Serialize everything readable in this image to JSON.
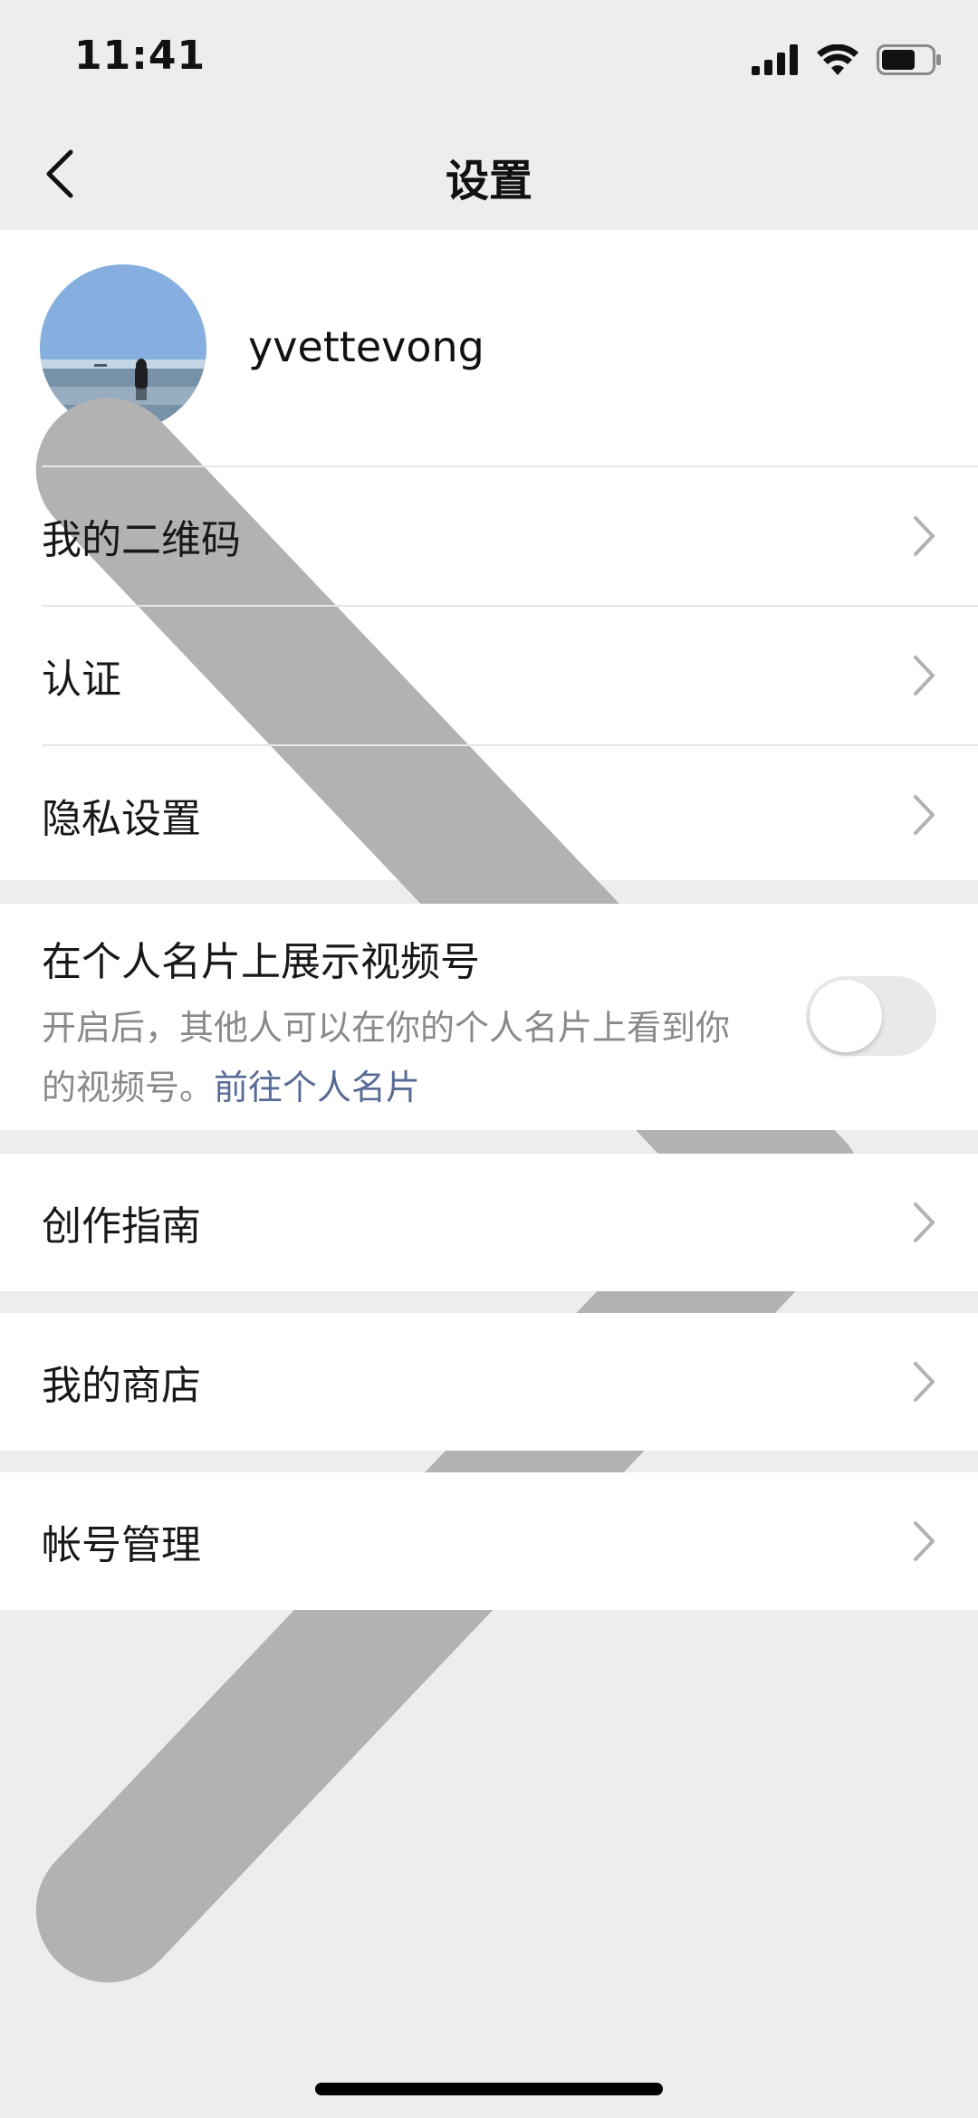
{
  "status_bar": {
    "time": "11:41",
    "icons": [
      "cellular-signal-icon",
      "wifi-icon",
      "battery-icon"
    ]
  },
  "nav": {
    "title": "设置",
    "back_icon": "chevron-left-icon"
  },
  "profile": {
    "username": "yvettevong"
  },
  "menu_group_1": {
    "qr_code_label": "我的二维码",
    "verification_label": "认证",
    "privacy_label": "隐私设置"
  },
  "channel_toggle": {
    "title": "在个人名片上展示视频号",
    "description": "开启后，其他人可以在你的个人名片上看到你的视频号。",
    "link_text": "前往个人名片",
    "enabled": false
  },
  "creation_guide": {
    "label": "创作指南"
  },
  "my_store": {
    "label": "我的商店"
  },
  "account_management": {
    "label": "帐号管理"
  },
  "colors": {
    "background": "#ededed",
    "card": "#ffffff",
    "text": "#181818",
    "secondary_text": "#8a8a8a",
    "link": "#576b95",
    "chevron": "#b2b2b2"
  }
}
